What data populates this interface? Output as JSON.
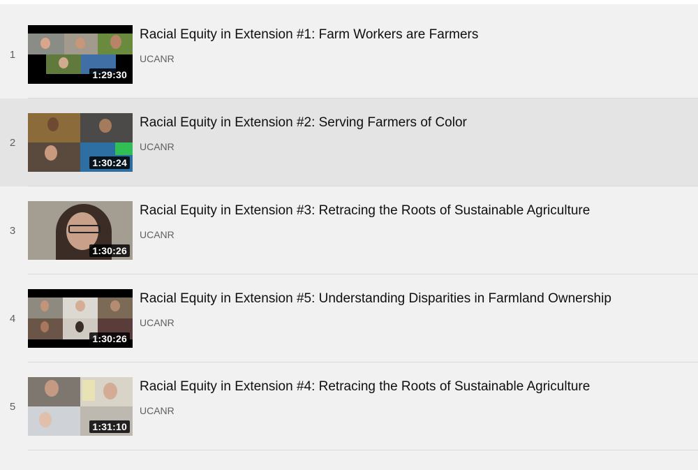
{
  "playlist": {
    "items": [
      {
        "index": "1",
        "title": "Racial Equity in Extension #1: Farm Workers are Farmers",
        "channel": "UCANR",
        "duration": "1:29:30"
      },
      {
        "index": "2",
        "title": "Racial Equity in Extension #2: Serving Farmers of Color",
        "channel": "UCANR",
        "duration": "1:30:24"
      },
      {
        "index": "3",
        "title": "Racial Equity in Extension #3: Retracing the Roots of Sustainable Agriculture",
        "channel": "UCANR",
        "duration": "1:30:26"
      },
      {
        "index": "4",
        "title": "Racial Equity in Extension #5: Understanding Disparities in Farmland Ownership",
        "channel": "UCANR",
        "duration": "1:30:26"
      },
      {
        "index": "5",
        "title": "Racial Equity in Extension #4: Retracing the Roots of Sustainable Agriculture",
        "channel": "UCANR",
        "duration": "1:31:10"
      }
    ]
  },
  "colors": {
    "background": "#f1f1f1",
    "active_row": "#e4e4e4",
    "title_text": "#0f0f0f",
    "meta_text": "#606060"
  }
}
